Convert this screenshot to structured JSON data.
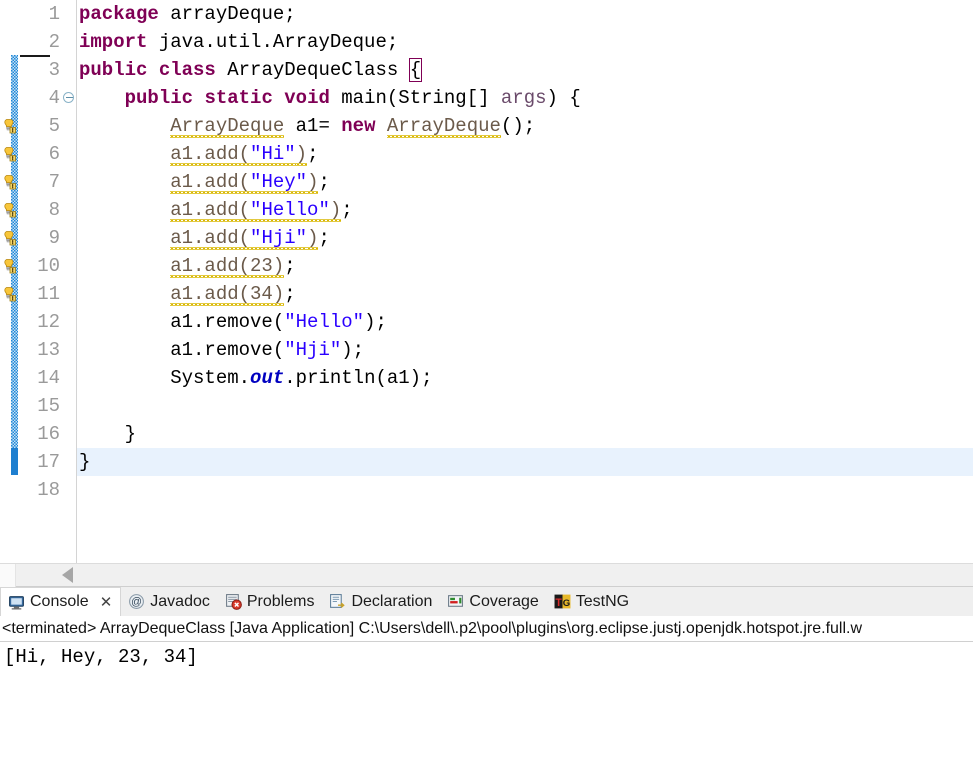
{
  "editor": {
    "line_numbers": [
      "1",
      "2",
      "3",
      "4",
      "5",
      "6",
      "7",
      "8",
      "9",
      "10",
      "11",
      "12",
      "13",
      "14",
      "15",
      "16",
      "17",
      "18"
    ],
    "current_line": 17,
    "fold_marker_line": 4,
    "code_lines": [
      {
        "n": "1",
        "segments": [
          {
            "t": "package",
            "c": "kw"
          },
          {
            "t": " arrayDeque;",
            "c": "plain"
          }
        ]
      },
      {
        "n": "2",
        "segments": [
          {
            "t": "import",
            "c": "kw"
          },
          {
            "t": " java.util.ArrayDeque;",
            "c": "plain"
          }
        ]
      },
      {
        "n": "3",
        "segments": [
          {
            "t": "public",
            "c": "kw"
          },
          {
            "t": " ",
            "c": "plain"
          },
          {
            "t": "class",
            "c": "kw"
          },
          {
            "t": " ArrayDequeClass ",
            "c": "plain"
          },
          {
            "t": "{",
            "c": "bracket"
          }
        ]
      },
      {
        "n": "4",
        "segments": [
          {
            "t": "    ",
            "c": "plain"
          },
          {
            "t": "public",
            "c": "kw"
          },
          {
            "t": " ",
            "c": "plain"
          },
          {
            "t": "static",
            "c": "kw"
          },
          {
            "t": " ",
            "c": "plain"
          },
          {
            "t": "void",
            "c": "kw"
          },
          {
            "t": " main(String[] ",
            "c": "plain"
          },
          {
            "t": "args",
            "c": "param"
          },
          {
            "t": ") {",
            "c": "plain"
          }
        ]
      },
      {
        "n": "5",
        "segments": [
          {
            "t": "        ",
            "c": "plain"
          },
          {
            "t": "ArrayDeque",
            "c": "warn"
          },
          {
            "t": " a1= ",
            "c": "plain"
          },
          {
            "t": "new",
            "c": "kw"
          },
          {
            "t": " ",
            "c": "plain"
          },
          {
            "t": "ArrayDeque",
            "c": "warn"
          },
          {
            "t": "();",
            "c": "plain"
          }
        ]
      },
      {
        "n": "6",
        "segments": [
          {
            "t": "        ",
            "c": "plain"
          },
          {
            "t": "a1.add(",
            "c": "warn"
          },
          {
            "t": "\"Hi\"",
            "c": "str-warn"
          },
          {
            "t": ")",
            "c": "warn"
          },
          {
            "t": ";",
            "c": "plain"
          }
        ]
      },
      {
        "n": "7",
        "segments": [
          {
            "t": "        ",
            "c": "plain"
          },
          {
            "t": "a1.add(",
            "c": "warn"
          },
          {
            "t": "\"Hey\"",
            "c": "str-warn"
          },
          {
            "t": ")",
            "c": "warn"
          },
          {
            "t": ";",
            "c": "plain"
          }
        ]
      },
      {
        "n": "8",
        "segments": [
          {
            "t": "        ",
            "c": "plain"
          },
          {
            "t": "a1.add(",
            "c": "warn"
          },
          {
            "t": "\"Hello\"",
            "c": "str-warn"
          },
          {
            "t": ")",
            "c": "warn"
          },
          {
            "t": ";",
            "c": "plain"
          }
        ]
      },
      {
        "n": "9",
        "segments": [
          {
            "t": "        ",
            "c": "plain"
          },
          {
            "t": "a1.add(",
            "c": "warn"
          },
          {
            "t": "\"Hji\"",
            "c": "str-warn"
          },
          {
            "t": ")",
            "c": "warn"
          },
          {
            "t": ";",
            "c": "plain"
          }
        ]
      },
      {
        "n": "10",
        "segments": [
          {
            "t": "        ",
            "c": "plain"
          },
          {
            "t": "a1.add(23)",
            "c": "warn"
          },
          {
            "t": ";",
            "c": "plain"
          }
        ]
      },
      {
        "n": "11",
        "segments": [
          {
            "t": "        ",
            "c": "plain"
          },
          {
            "t": "a1.add(34)",
            "c": "warn"
          },
          {
            "t": ";",
            "c": "plain"
          }
        ]
      },
      {
        "n": "12",
        "segments": [
          {
            "t": "        ",
            "c": "plain"
          },
          {
            "t": "a1.remove(",
            "c": "plain"
          },
          {
            "t": "\"Hello\"",
            "c": "str"
          },
          {
            "t": ");",
            "c": "plain"
          }
        ]
      },
      {
        "n": "13",
        "segments": [
          {
            "t": "        ",
            "c": "plain"
          },
          {
            "t": "a1.remove(",
            "c": "plain"
          },
          {
            "t": "\"Hji\"",
            "c": "str"
          },
          {
            "t": ");",
            "c": "plain"
          }
        ]
      },
      {
        "n": "14",
        "segments": [
          {
            "t": "        ",
            "c": "plain"
          },
          {
            "t": "System.",
            "c": "plain"
          },
          {
            "t": "out",
            "c": "fld"
          },
          {
            "t": ".println(a1);",
            "c": "plain"
          }
        ]
      },
      {
        "n": "15",
        "segments": [
          {
            "t": "",
            "c": "plain"
          }
        ]
      },
      {
        "n": "16",
        "segments": [
          {
            "t": "    }",
            "c": "plain"
          }
        ]
      },
      {
        "n": "17",
        "segments": [
          {
            "t": "}",
            "c": "plain"
          }
        ]
      },
      {
        "n": "18",
        "segments": [
          {
            "t": "",
            "c": "plain"
          }
        ]
      }
    ],
    "warning_marker_lines": [
      5,
      6,
      7,
      8,
      9,
      10,
      11
    ],
    "warning_icon_name": "warning-lightbulb-icon",
    "scrollbar": {
      "left_arrow_name": "scroll-left-arrow"
    }
  },
  "colors": {
    "keyword": "#7f0055",
    "string": "#2a00ff",
    "field": "#0000c0",
    "current_line": "#e8f2fd",
    "change_bar": "#1e88d8",
    "warning_squiggle": "#d9b700"
  },
  "bottom_panel": {
    "tabs": [
      {
        "label": "Console",
        "icon": "console-monitor-icon",
        "active": true,
        "closable": true,
        "close_glyph": "✕"
      },
      {
        "label": "Javadoc",
        "icon": "javadoc-at-icon",
        "active": false,
        "closable": false
      },
      {
        "label": "Problems",
        "icon": "problems-error-icon",
        "active": false,
        "closable": false
      },
      {
        "label": "Declaration",
        "icon": "declaration-icon",
        "active": false,
        "closable": false
      },
      {
        "label": "Coverage",
        "icon": "coverage-icon",
        "active": false,
        "closable": false
      },
      {
        "label": "TestNG",
        "icon": "testng-icon",
        "active": false,
        "closable": false
      }
    ],
    "launch_line": "<terminated> ArrayDequeClass [Java Application] C:\\Users\\dell\\.p2\\pool\\plugins\\org.eclipse.justj.openjdk.hotspot.jre.full.w",
    "console_output": "[Hi, Hey, 23, 34]"
  }
}
